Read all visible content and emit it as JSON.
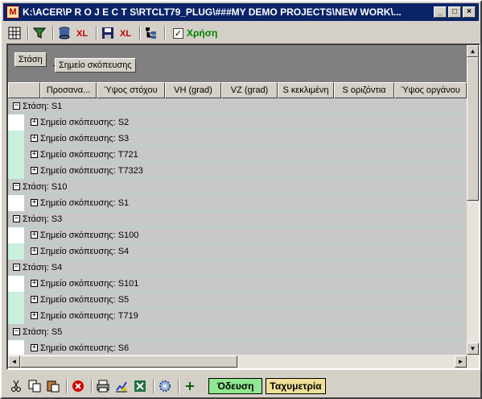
{
  "window": {
    "title": "K:\\ACER\\P R O J E C T S\\RTCLT79_PLUG\\###MY DEMO PROJECTS\\NEW WORK\\...",
    "app_icon_letter": "M",
    "controls": {
      "minimize": "_",
      "maximize": "□",
      "close": "×"
    }
  },
  "toolbar": {
    "checkbox_checked": true,
    "checkbox_mark": "✓",
    "checkbox_label": "Χρήση",
    "icons": [
      "grid-icon",
      "filter-icon",
      "database-icon",
      "excel-icon",
      "save-icon",
      "excel-export-icon",
      "tree-icon"
    ]
  },
  "group_area": {
    "chip1": "Στάση",
    "chip2": "Σημείο σκόπευσης"
  },
  "columns": [
    "",
    "Προσανα...",
    "Ύψος στόχου",
    "VH (grad)",
    "VZ (grad)",
    "S κεκλιμένη",
    "S οριζόντια",
    "Ύψος οργάνου"
  ],
  "rows": [
    {
      "type": "group",
      "expander": "−",
      "text": "Στάση: S1"
    },
    {
      "type": "child",
      "expander": "+",
      "text": "Σημείο σκόπευσης: S2"
    },
    {
      "type": "child",
      "expander": "+",
      "text": "Σημείο σκόπευσης: S3"
    },
    {
      "type": "child",
      "expander": "+",
      "text": "Σημείο σκόπευσης: T721"
    },
    {
      "type": "child",
      "expander": "+",
      "text": "Σημείο σκόπευσης: T7323"
    },
    {
      "type": "group",
      "expander": "−",
      "text": "Στάση: S10"
    },
    {
      "type": "child",
      "expander": "+",
      "text": "Σημείο σκόπευσης: S1"
    },
    {
      "type": "group",
      "expander": "−",
      "text": "Στάση: S3"
    },
    {
      "type": "child",
      "expander": "+",
      "text": "Σημείο σκόπευσης: S100"
    },
    {
      "type": "child",
      "expander": "+",
      "text": "Σημείο σκόπευσης: S4"
    },
    {
      "type": "group",
      "expander": "−",
      "text": "Στάση: S4"
    },
    {
      "type": "child",
      "expander": "+",
      "text": "Σημείο σκόπευσης: S101"
    },
    {
      "type": "child",
      "expander": "+",
      "text": "Σημείο σκόπευσης: S5"
    },
    {
      "type": "child",
      "expander": "+",
      "text": "Σημείο σκόπευσης: T719"
    },
    {
      "type": "group",
      "expander": "−",
      "text": "Στάση: S5"
    },
    {
      "type": "child",
      "expander": "+",
      "text": "Σημείο σκόπευσης: S6"
    }
  ],
  "scroll": {
    "up": "▲",
    "down": "▼",
    "left": "◄",
    "right": "►"
  },
  "bottom": {
    "buttons": [
      "Όδευση",
      "Ταχυμετρία"
    ],
    "icons": [
      "cut-icon",
      "copy-icon",
      "paste-icon",
      "delete-icon",
      "print-icon",
      "chart-icon",
      "excel-icon",
      "settings-icon",
      "add-icon"
    ]
  }
}
